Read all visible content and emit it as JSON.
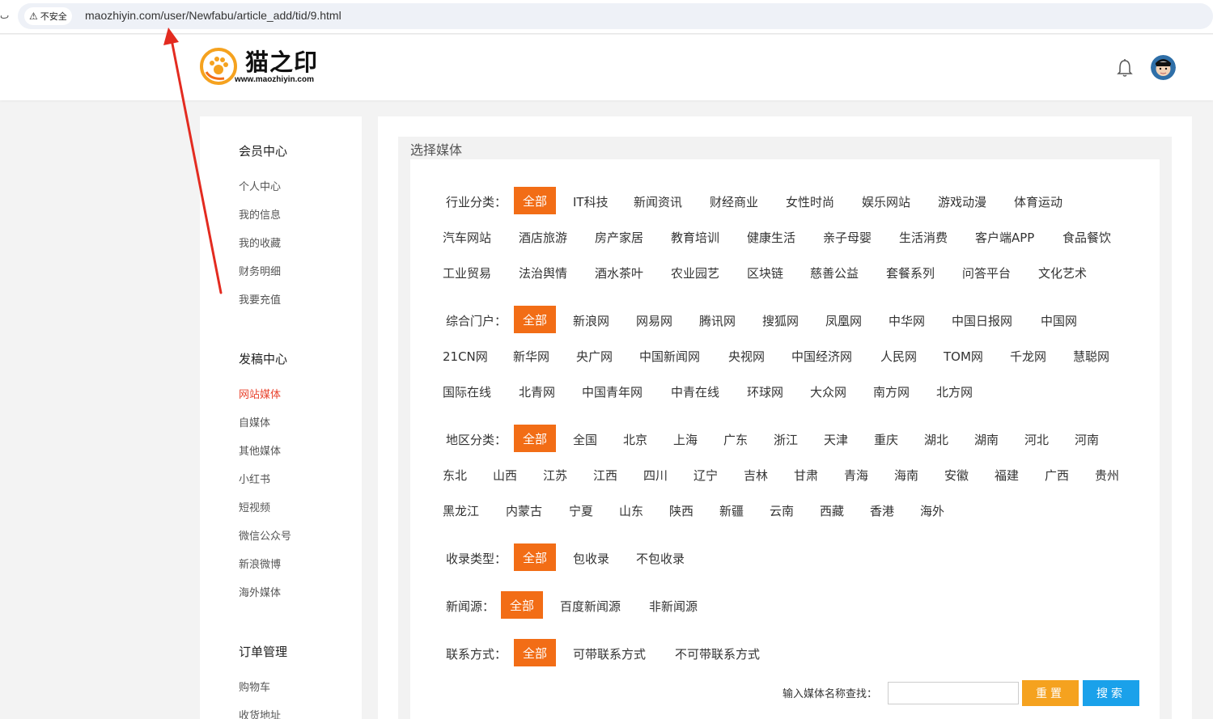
{
  "browser": {
    "reload_glyph": "ٮ",
    "insecure_label": "不安全",
    "url": "maozhiyin.com/user/Newfabu/article_add/tid/9.html"
  },
  "header": {
    "logo_name": "猫之印",
    "logo_url": "www.maozhiyin.com"
  },
  "sidebar": {
    "groups": [
      {
        "title": "会员中心",
        "items": [
          "个人中心",
          "我的信息",
          "我的收藏",
          "财务明细",
          "我要充值"
        ]
      },
      {
        "title": "发稿中心",
        "items": [
          "网站媒体",
          "自媒体",
          "其他媒体",
          "小红书",
          "短视频",
          "微信公众号",
          "新浪微博",
          "海外媒体"
        ]
      },
      {
        "title": "订单管理",
        "items": [
          "购物车",
          "收货地址"
        ]
      }
    ],
    "active_item": "网站媒体"
  },
  "main": {
    "title": "选择媒体",
    "all_label": "全部",
    "industry": {
      "label": "行业分类：",
      "row1": [
        "IT科技",
        "新闻资讯",
        "财经商业",
        "女性时尚",
        "娱乐网站",
        "游戏动漫",
        "体育运动"
      ],
      "row2": [
        "汽车网站",
        "酒店旅游",
        "房产家居",
        "教育培训",
        "健康生活",
        "亲子母婴",
        "生活消费",
        "客户端APP",
        "食品餐饮"
      ],
      "row3": [
        "工业贸易",
        "法治舆情",
        "酒水茶叶",
        "农业园艺",
        "区块链",
        "慈善公益",
        "套餐系列",
        "问答平台",
        "文化艺术"
      ]
    },
    "portal": {
      "label": "综合门户：",
      "row1": [
        "新浪网",
        "网易网",
        "腾讯网",
        "搜狐网",
        "凤凰网",
        "中华网",
        "中国日报网",
        "中国网"
      ],
      "row2": [
        "21CN网",
        "新华网",
        "央广网",
        "中国新闻网",
        "央视网",
        "中国经济网",
        "人民网",
        "TOM网",
        "千龙网",
        "慧聪网"
      ],
      "row3": [
        "国际在线",
        "北青网",
        "中国青年网",
        "中青在线",
        "环球网",
        "大众网",
        "南方网",
        "北方网"
      ]
    },
    "region": {
      "label": "地区分类：",
      "row1": [
        "全国",
        "北京",
        "上海",
        "广东",
        "浙江",
        "天津",
        "重庆",
        "湖北",
        "湖南",
        "河北",
        "河南"
      ],
      "row2": [
        "东北",
        "山西",
        "江苏",
        "江西",
        "四川",
        "辽宁",
        "吉林",
        "甘肃",
        "青海",
        "海南",
        "安徽",
        "福建",
        "广西",
        "贵州"
      ],
      "row3": [
        "黑龙江",
        "内蒙古",
        "宁夏",
        "山东",
        "陕西",
        "新疆",
        "云南",
        "西藏",
        "香港",
        "海外"
      ]
    },
    "index_type": {
      "label": "收录类型：",
      "options": [
        "包收录",
        "不包收录"
      ]
    },
    "news_source": {
      "label": "新闻源：",
      "options": [
        "百度新闻源",
        "非新闻源"
      ]
    },
    "contact": {
      "label": "联系方式：",
      "options": [
        "可带联系方式",
        "不可带联系方式"
      ]
    },
    "search": {
      "label": "输入媒体名称查找：",
      "input_value": "",
      "reset_label": "重置",
      "search_label": "搜索"
    }
  },
  "colors": {
    "accent_orange": "#f26d16",
    "reset_yellow": "#f5a21f",
    "search_blue": "#1aa1ea",
    "active_red": "#e8432e",
    "annotation_red": "#e32b20"
  }
}
